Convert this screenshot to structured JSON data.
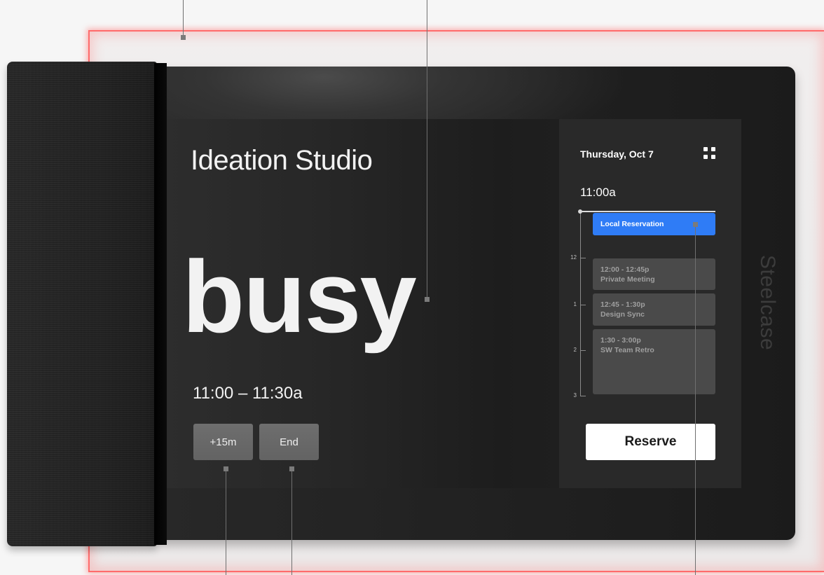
{
  "device": {
    "brand": "Steelcase"
  },
  "room": {
    "name": "Ideation Studio",
    "status": "busy",
    "time_range": "11:00 – 11:30a"
  },
  "actions": {
    "extend_label": "+15m",
    "end_label": "End"
  },
  "schedule": {
    "date": "Thursday, Oct 7",
    "menu_icon": "grid-icon",
    "current_time": "11:00a",
    "hour_labels": [
      "12",
      "1",
      "2",
      "3"
    ],
    "current_reservation": "Local Reservation",
    "events": [
      {
        "time": "12:00 - 12:45p",
        "title": "Private Meeting"
      },
      {
        "time": "12:45 - 1:30p",
        "title": "Design Sync"
      },
      {
        "time": "1:30 - 3:00p",
        "title": "SW Team Retro"
      }
    ],
    "reserve_label": "Reserve"
  },
  "colors": {
    "status_led": "#ff6b6b",
    "accent": "#2f7cf6",
    "event_bg": "#4a4a4a",
    "screen_bg": "#262626",
    "button_bg": "#6a6a6a"
  }
}
